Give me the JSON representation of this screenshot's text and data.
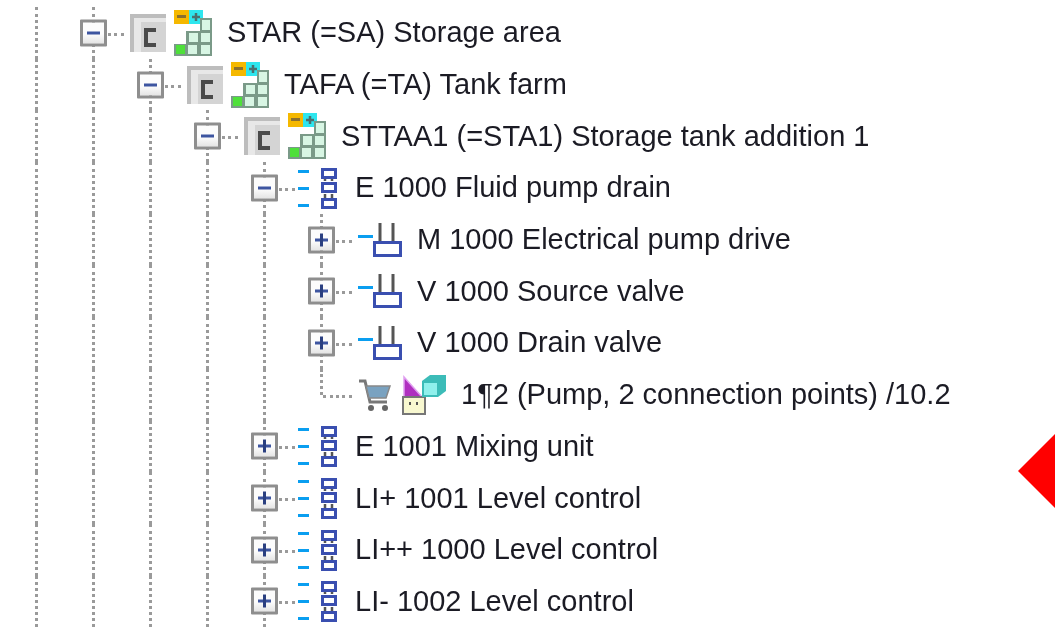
{
  "tree": [
    {
      "kind": "area",
      "label": "STAR (=SA) Storage area",
      "expanded": true,
      "children": [
        {
          "kind": "area",
          "label": "TAFA (=TA) Tank farm",
          "expanded": true,
          "children": [
            {
              "kind": "area",
              "label": "STTAA1 (=STA1) Storage tank addition 1",
              "expanded": true,
              "children": [
                {
                  "kind": "function",
                  "label": "E 1000 Fluid pump drain",
                  "expanded": true,
                  "children": [
                    {
                      "kind": "device",
                      "label": "M 1000 Electrical pump drive",
                      "expanded": false
                    },
                    {
                      "kind": "device",
                      "label": "V 1000 Source valve",
                      "expanded": false
                    },
                    {
                      "kind": "device",
                      "label": "V 1000 Drain valve",
                      "expanded": false
                    },
                    {
                      "kind": "part",
                      "label": "1¶2 (Pump, 2 connection points) /10.2"
                    }
                  ]
                },
                {
                  "kind": "function",
                  "label": "E 1001 Mixing unit",
                  "expanded": false
                },
                {
                  "kind": "function",
                  "label": "LI+ 1001 Level control",
                  "expanded": false
                },
                {
                  "kind": "function",
                  "label": "LI++ 1000 Level control",
                  "expanded": false
                },
                {
                  "kind": "function",
                  "label": "LI- 1002 Level control",
                  "expanded": false
                }
              ]
            }
          ]
        }
      ]
    }
  ]
}
